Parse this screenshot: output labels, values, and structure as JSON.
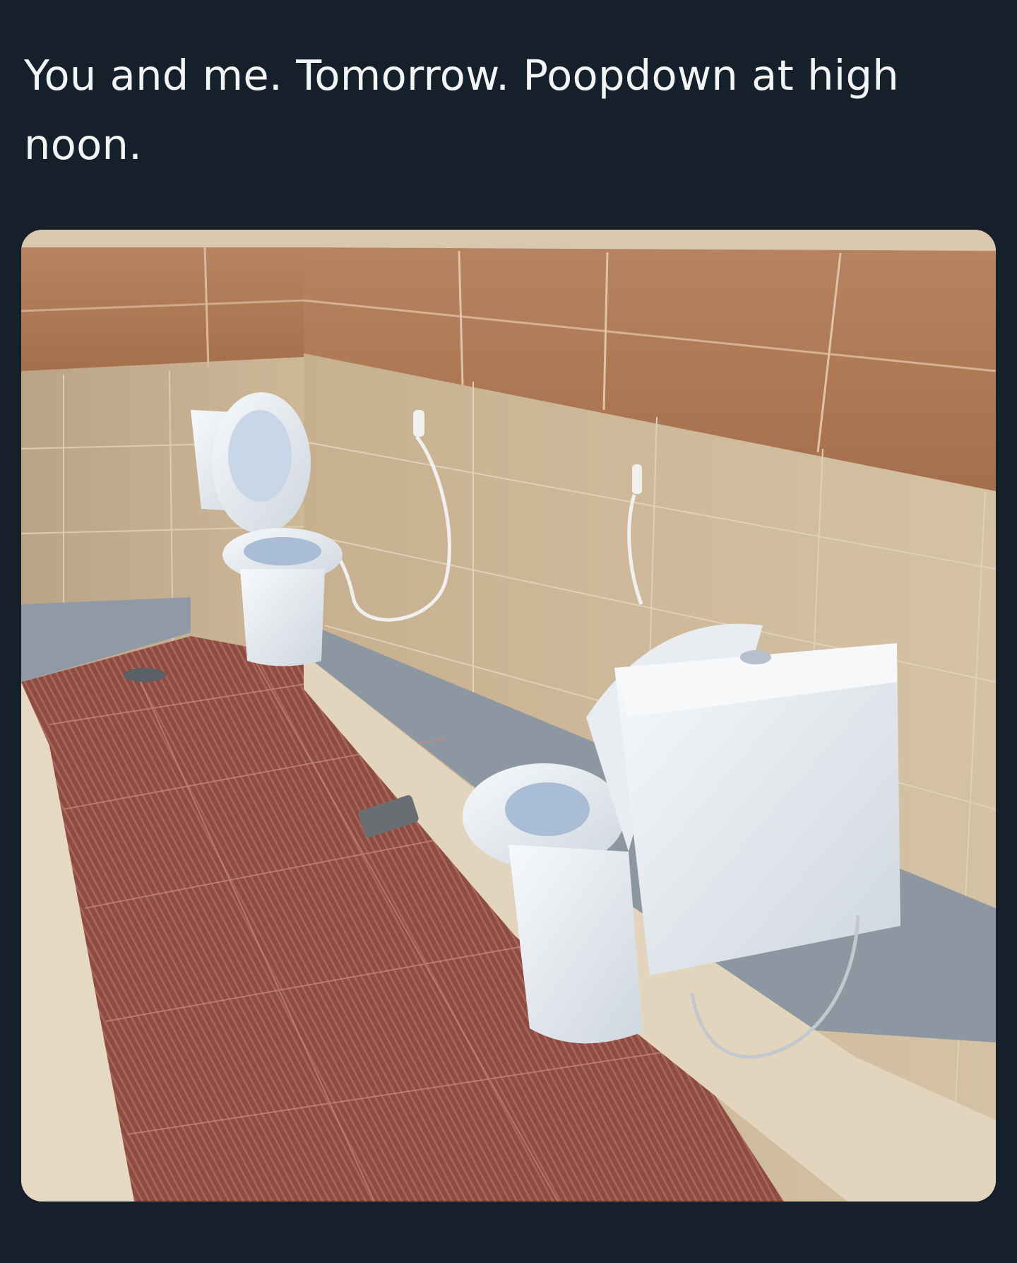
{
  "post": {
    "text": "You and me. Tomorrow. Poopdown at high noon."
  },
  "media": {
    "alt": "Bathroom with two toilets facing each other along a tiled wall",
    "colors": {
      "background": "#16202b",
      "text": "#f2f4f6",
      "wall_tile": "#c9b394",
      "wood_band": "#b07a55",
      "floor_tile": "#8e4e43",
      "porcelain": "#eef1f5"
    },
    "icon_names": [
      "photo-image"
    ]
  }
}
